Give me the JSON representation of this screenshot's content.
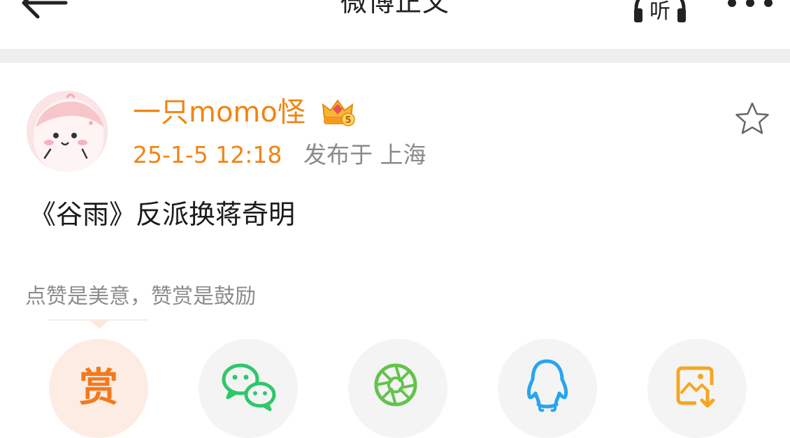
{
  "nav": {
    "title": "微博正文",
    "back_icon": "arrow-left-icon",
    "listen_label": "听",
    "listen_icon": "headphones-icon",
    "more_icon": "more-dots-icon"
  },
  "post": {
    "author": "一只momo怪",
    "author_badge_icon": "crown-badge-icon",
    "author_badge_level": "5",
    "time": "25-1-5 12:18",
    "location": "发布于 上海",
    "favorite_icon": "star-icon",
    "text": "《谷雨》反派换蒋奇明"
  },
  "reward": {
    "hint": "点赞是美意，赞赏是鼓励",
    "button_label": "赏"
  },
  "share": {
    "icons": [
      "wechat-icon",
      "moments-icon",
      "qq-icon",
      "save-image-icon"
    ]
  },
  "colors": {
    "accent_orange": "#f08414",
    "meta_gray": "#8a8a8a",
    "wechat_green": "#2ec76b",
    "moments_green": "#63c34c",
    "qq_blue": "#27a4f0",
    "save_orange": "#f5a623"
  }
}
